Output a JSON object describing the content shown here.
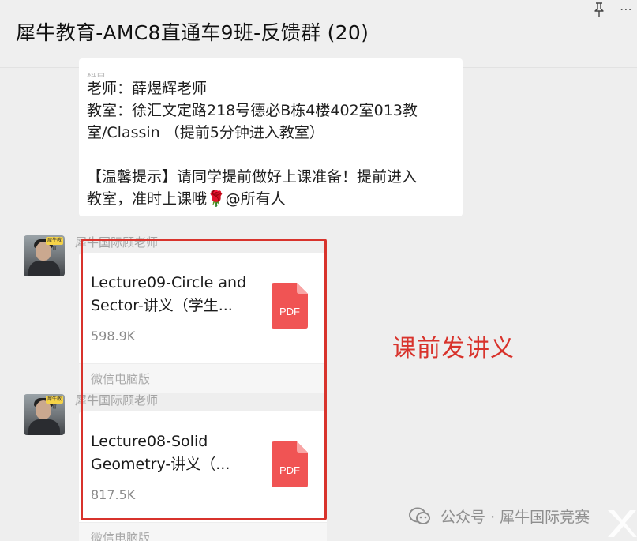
{
  "header": {
    "title": "犀牛教育-AMC8直通车9班-反馈群 (20)",
    "more_glyph": "⋯"
  },
  "top_message": {
    "cut_text": "科目",
    "line_teacher": "老师：薛煜辉老师",
    "line_room_1": "教室：徐汇文定路218号德必B栋4楼402室013教",
    "line_room_2": "室/Classin （提前5分钟进入教室）",
    "tip_line_1": "【温馨提示】请同学提前做好上课准备！提前进入",
    "tip_line_2": "教室，准时上课哦🌹@所有人"
  },
  "messages": [
    {
      "sender": "犀牛国际顾老师",
      "avatar_tag": "犀牛教育",
      "file_name_line1": "Lecture09-Circle and",
      "file_name_line2": "Sector-讲义（学生...",
      "file_size": "598.9K",
      "file_icon": "pdf-icon",
      "file_icon_text": "PDF",
      "footer": "微信电脑版"
    },
    {
      "sender": "犀牛国际顾老师",
      "avatar_tag": "犀牛教育",
      "file_name_line1": "Lecture08-Solid",
      "file_name_line2": "Geometry-讲义（...",
      "file_size": "817.5K",
      "file_icon": "pdf-icon",
      "file_icon_text": "PDF",
      "footer": "微信电脑版"
    }
  ],
  "annotation": {
    "note": "课前发讲义",
    "color": "#d8332c"
  },
  "watermark": {
    "text": "公众号 · 犀牛国际竞赛",
    "icon": "wechat-official-account-icon"
  },
  "colors": {
    "accent_red": "#d8332c",
    "pdf_red": "#f05454",
    "bubble_bg": "#ffffff",
    "chat_bg": "#eeeeee"
  }
}
